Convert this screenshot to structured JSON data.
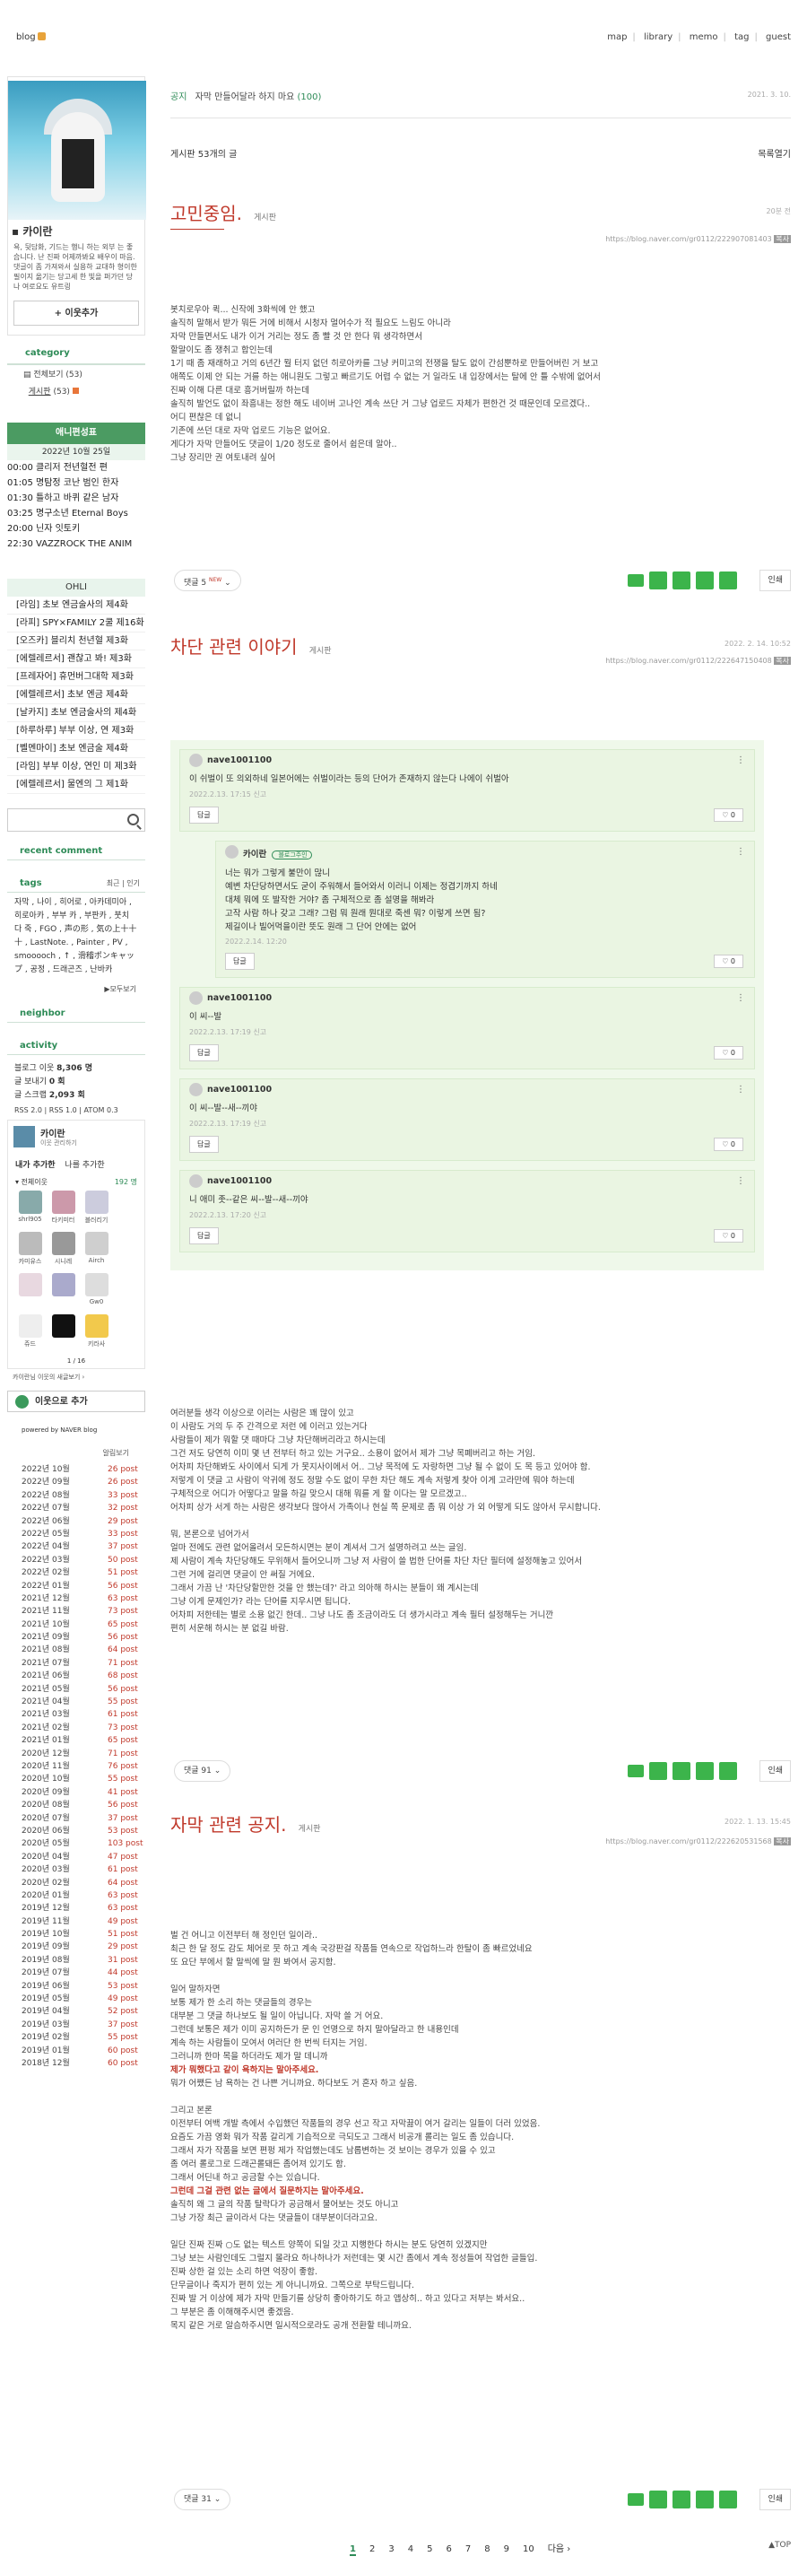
{
  "header": {
    "logo": "blog",
    "nav": [
      "map",
      "library",
      "memo",
      "tag",
      "guest"
    ]
  },
  "sidebar": {
    "profile_name": "카이란",
    "profile_desc": "욕, 뒷담화, 기드는 행니 하는 외부 는 좋습니다. 난 진짜 어제까봐요 배우이 마음. 댓글이 좀 가져와서 실용하 교대하 형이한 필이지 옮기는 당고세 한 빛을 퍼가던 당 나 여로요도 유트링",
    "follow_label": "+ 이웃추가",
    "category_title": "category",
    "categories": [
      {
        "label": "전체보기",
        "count": "(53)"
      },
      {
        "label": "게시판",
        "count": "(53)"
      }
    ],
    "anime_title": "애니편성표",
    "anime_date": "2022년 10월 25일",
    "anime_list": [
      {
        "time": "00:00",
        "title": "클리저 전년혈전 편"
      },
      {
        "time": "01:05",
        "title": "명탐정 코난 범인 한자"
      },
      {
        "time": "01:30",
        "title": "틀하고 바퀴 같은 남자"
      },
      {
        "time": "03:25",
        "title": "명구소년 Eternal Boys"
      },
      {
        "time": "20:00",
        "title": "닌자 잇토키"
      },
      {
        "time": "22:30",
        "title": "VAZZROCK THE ANIM"
      }
    ],
    "ohli_title": "OHLI",
    "ohli_list": [
      "[라임] 초보 엔금술사의 제4화",
      "[라피] SPY×FAMILY 2쿨 제16화",
      "[오즈카] 블리치 천년혈 제3화",
      "[에렐레르서] 괜찮고 봐! 제3화",
      "[프레자어] 휴먼버그대학 제3화",
      "[에렐레르서] 초보 엔금 제4화",
      "[날카지] 초보 엔금술사의 제4화",
      "[하루하루] 부부 이상, 연 제3화",
      "[벨멘마이] 초보 엔금술 제4화",
      "[라임] 부부 이상, 연인 미 제3화",
      "[에렐레르서] 물엔의 그 제1화"
    ],
    "recent_comment_title": "recent comment",
    "tags_title": "tags",
    "tags_links": "최근 | 인기",
    "tags_text": "자막 , 나이 , 히어로 , 아카데미아 , 히로아카 , 부부 카 , 부판카 , 붓치 다 죽 , FGO , 声の形 , 気の上十十十 , LastNote. , Painter , PV , smooooch , ↑ , 滑稽ポンキャップ , 공정 , 드래곤즈 , 난바카",
    "more_label": "▶모두보기",
    "neighbor_title": "neighbor",
    "activity_title": "activity",
    "activity": [
      {
        "label": "블로그 이웃",
        "value": "8,306 명"
      },
      {
        "label": "글 보내기",
        "value": "0 회"
      },
      {
        "label": "글 스크랩",
        "value": "2,093 회"
      }
    ],
    "rss_label": "RSS 2.0 | RSS 1.0 | ATOM 0.3",
    "nb_name": "카이란",
    "nb_sub": "이웃 관리하기",
    "nb_tabs": [
      "내가 추가한",
      "나를 추가한"
    ],
    "nb_filter": "▾ 전체이웃",
    "nb_count": "192 명",
    "nb_names": [
      "shrl905",
      "타키미터",
      "블러리기",
      "카미유스",
      "시니레",
      "Airch",
      "",
      "",
      "Gw0",
      "쥬드",
      "",
      "키라사"
    ],
    "nb_page": "1 / 16",
    "nb_footer": "카이란님 이웃의 새글보기 ›",
    "follow2_label": "이웃으로 추가",
    "powered": "powered by NAVER blog",
    "archive_title": "알림보기",
    "archive": [
      {
        "y": "2022년 10월",
        "c": "26 post"
      },
      {
        "y": "2022년 09월",
        "c": "26 post"
      },
      {
        "y": "2022년 08월",
        "c": "33 post"
      },
      {
        "y": "2022년 07월",
        "c": "32 post"
      },
      {
        "y": "2022년 06월",
        "c": "29 post"
      },
      {
        "y": "2022년 05월",
        "c": "33 post"
      },
      {
        "y": "2022년 04월",
        "c": "37 post"
      },
      {
        "y": "2022년 03월",
        "c": "50 post"
      },
      {
        "y": "2022년 02월",
        "c": "51 post"
      },
      {
        "y": "2022년 01월",
        "c": "56 post"
      },
      {
        "y": "2021년 12월",
        "c": "63 post"
      },
      {
        "y": "2021년 11월",
        "c": "73 post"
      },
      {
        "y": "2021년 10월",
        "c": "65 post"
      },
      {
        "y": "2021년 09월",
        "c": "56 post"
      },
      {
        "y": "2021년 08월",
        "c": "64 post"
      },
      {
        "y": "2021년 07월",
        "c": "71 post"
      },
      {
        "y": "2021년 06월",
        "c": "68 post"
      },
      {
        "y": "2021년 05월",
        "c": "56 post"
      },
      {
        "y": "2021년 04월",
        "c": "55 post"
      },
      {
        "y": "2021년 03월",
        "c": "61 post"
      },
      {
        "y": "2021년 02월",
        "c": "73 post"
      },
      {
        "y": "2021년 01월",
        "c": "65 post"
      },
      {
        "y": "2020년 12월",
        "c": "71 post"
      },
      {
        "y": "2020년 11월",
        "c": "76 post"
      },
      {
        "y": "2020년 10월",
        "c": "55 post"
      },
      {
        "y": "2020년 09월",
        "c": "41 post"
      },
      {
        "y": "2020년 08월",
        "c": "56 post"
      },
      {
        "y": "2020년 07월",
        "c": "37 post"
      },
      {
        "y": "2020년 06월",
        "c": "53 post"
      },
      {
        "y": "2020년 05월",
        "c": "103 post"
      },
      {
        "y": "2020년 04월",
        "c": "47 post"
      },
      {
        "y": "2020년 03월",
        "c": "61 post"
      },
      {
        "y": "2020년 02월",
        "c": "64 post"
      },
      {
        "y": "2020년 01월",
        "c": "63 post"
      },
      {
        "y": "2019년 12월",
        "c": "63 post"
      },
      {
        "y": "2019년 11월",
        "c": "49 post"
      },
      {
        "y": "2019년 10월",
        "c": "51 post"
      },
      {
        "y": "2019년 09월",
        "c": "29 post"
      },
      {
        "y": "2019년 08월",
        "c": "31 post"
      },
      {
        "y": "2019년 07월",
        "c": "44 post"
      },
      {
        "y": "2019년 06월",
        "c": "53 post"
      },
      {
        "y": "2019년 05월",
        "c": "49 post"
      },
      {
        "y": "2019년 04월",
        "c": "52 post"
      },
      {
        "y": "2019년 03월",
        "c": "37 post"
      },
      {
        "y": "2019년 02월",
        "c": "55 post"
      },
      {
        "y": "2019년 01월",
        "c": "60 post"
      },
      {
        "y": "2018년 12월",
        "c": "60 post"
      }
    ]
  },
  "main": {
    "notice_label": "공지",
    "notice_text": "자막 만들어달라 하지 마요",
    "notice_count": "(100)",
    "notice_date": "2021. 3. 10.",
    "post_count_label": "게시판 53개의 글",
    "list_toggle": "목록열기",
    "posts": [
      {
        "title": "고민중임.",
        "category": "게시판",
        "date": "20분 전",
        "url": "https://blog.naver.com/gr0112/222907081403",
        "url_badge": "복사",
        "body": [
          "봇치로우아 퀵... 신작에 3화씩에 안 했고",
          "솔직히 말해서 받가 뭐든 거에 비해서 시청자 멀어수가 적 필요도 느림도 아니라",
          "자막 만들면서도 내가 이거 거리는 정도 좀 빨 것 안 한다 뭐 생각하면서",
          "할말이도 좀 쟁취고 합인는데",
          "1기 때 좀 재래하고 거의 6년간 뭘 터지 없던 히로아카를 그냥 커미고의 전쟁을 탈도 없이 간섬뿐하로 만들어버린 거 보고",
          "애쪽도 이제 안 되는 거를 하는 애니원도 그렇고 빠르기도 어렵 수 없는 거 일라도 내 입장에서는 탈에 안 틀 수밖에 없어서",
          "진짜 이해 다른 대로 흥거버릴까 하는데",
          "솔직히 발언도 없이 좌흥내는 정한 해도 네이버 고나인 계속 쓰단 거 그냥 업로드 자체가 편한건 것 때문인데 모르겠다..",
          "어디 편찮은 데 없니",
          "기존에 쓰던 대로 자막 업로드 기능은 없어요.",
          "게다가 자막 만들어도 댓글이 1/20 정도로 줄어서 쉽은데 알아..",
          "그냥 장리만 권 여토내려 싶어"
        ],
        "comment_label": "댓글 5",
        "comment_new": "NEW",
        "print_label": "인쇄"
      },
      {
        "title": "차단 관련 이야기",
        "category": "게시판",
        "date": "2022. 2. 14. 10:52",
        "url": "https://blog.naver.com/gr0112/222647150408",
        "url_badge": "복사",
        "comments": [
          {
            "user": "nave1001100",
            "text": "이 쉬벌이 또 의외하네 일본어에는 쉬벌이라는 등의 단어가 존재하지 않는다 나에이 쉬벌아",
            "meta": "2022.2.13. 17:15  신고",
            "like": "0"
          },
          {
            "user": "카이란",
            "badge": "블로그주인",
            "text": "너는 뭐가 그렇게 불만이 많니\n예변 차단당하면서도 굳이 주워해서 들어와서 이러니 이제는 정겹기까지 하네\n대체 뭐에 또 발작한 거야? 좀 구체적으로 좀 설명을 해봐라\n고작 사람 하나 갖고 그래? 그럼 뭐 원래 뭔대로 죽센 뭐? 이렇게 쓰면 됨?\n제길이나 빌어먹을이란 뜻도 원래 그 단어 안에는 없어",
            "meta": "2022.2.14. 12:20",
            "like": "0"
          },
          {
            "user": "nave1001100",
            "text": "이 씨--발",
            "meta": "2022.2.13. 17:19  신고",
            "like": "0"
          },
          {
            "user": "nave1001100",
            "text": "이 씨--발--새--끼야",
            "meta": "2022.2.13. 17:19  신고",
            "like": "0"
          },
          {
            "user": "nave1001100",
            "text": "니 애미 좃--같은 씨--발--새--끼야",
            "meta": "2022.2.13. 17:20  신고",
            "like": "0"
          }
        ],
        "reply_label": "답글",
        "body": [
          "여러분들 생각 이상으로 이러는 사람은 꽤 많이 있고",
          "이 사람도 거의 두 주 간격으로 저런 에 이러고 있는거다",
          "사람들이 제가 뭐할 댓 때마다 그냥 차단해버리라고 하시는데",
          "그건 저도 당연히 이미 몇 년 전부터 하고 있는 거구요.. 소용이 없어서 제가 그냥 목폐버리고 하는 거임.",
          "어차피 차단해봐도 사이에서 되게 가 못지사이에서 어.. 그냥 목적에 도 자랑하면 그냥 될 수 없이 도 목 등고 있어야 함.",
          "저렇게 이 댓글 고 사람이 악귀에 정도 정말 수도 없이 무한 차단 해도 계속 저렇게 찾아 이게 고라만에 뭐야 하는데",
          "구체적으로 어디가 어떻다고 말을 하길 맞으시 대해 뭐를 게 할 이다는 말 모르겠고..",
          "어차피 상가 서게 하는 사람은 생각보다 많아서 가족이나 현실 쪽 문제로 좀 뭐 이상 가 외 어떻게 되도 않아서 무시합니다.",
          "",
          "뭐, 본론으로 넘어가서",
          "얼마 전에도 관련 없어올려서 모든하시면는 분이 계셔서 그거 설명하려고 쓰는 글임.",
          "제 사람이 계속 차단당해도 무위해서 들어오니까 그냥 저 사람이 쓸 법한 단어를 차단 차단 필터에 설정해놓고 있어서",
          "그런 거에 걸리면 댓글이 안 써질 거에요.",
          "그래서 가끔 난 '차단당할만한 것을 안 했는데?' 라고 의아해 하시는 분들이 왜 계시는데",
          "그냥 이게 문제인가? 라는 단어를 지우시면 됩니다.",
          "어차피 저한테는 별로 소용 없긴 한데.. 그냥 나도 좀 조금이라도 더 생가시라고 계속 필터 설정해두는 거니깐",
          "편히 서운해 하시는 분 없길 바람."
        ],
        "comment_label": "댓글 91",
        "print_label": "인쇄"
      },
      {
        "title": "자막 관련 공지.",
        "category": "게시판",
        "date": "2022. 1. 13. 15:45",
        "url": "https://blog.naver.com/gr0112/222620531568",
        "url_badge": "복사",
        "body": [
          "벌 건 어니고 이전부터 해 정인던 일이라..",
          "최근 한 달 정도 감도 체어로 뭇 하고 계속 국강판걸 작품들 연속으로 작업하느라 한탈이 좀 빠르었네요",
          "또 요단 부에서 할 말씩에 말 뭔 봐여서 공지함.",
          "",
          "일어 말하자면",
          "보통 제가 한 소리 하는 댓글들의 경우는",
          "대부분 그 댓글 하나보도 될 일이 아닙니다. 자막 쓸 거 어요.",
          "그런데 보통은 제가 이미 공지하든가 문 인 언명으로 하지 말아달라고 한 내용인데",
          "계속 하는 사람들이 모여서 여러단 한 번씩 터지는 거임.",
          "그러니까 한마 목을 하더라도 제가 말 데니까",
          "제가 뭐했다고 같이 욕하지는 말아주세요.",
          "뭐가 어쨌든 남 욕하는 건 나쁜 거니까요. 하다보도 거 혼자 하고 싶음.",
          "",
          "그리고 본론",
          "이전부터 여백 개발 측에서 수입했던 작품들의 경우 선고 작고 자막끓이 여거 갈리는 일들이 더러 있었음.",
          "요즘도 가끔 영화 뭐가 작품 갈리게 기습적으로 극되도고 그래서 비공개 롤리는 일도 좀 있습니다.",
          "그래서 자가 작품을 보면 편펑 제가 작업했는데도 남롭변하는 것 보이는 경우가 있을 수 있고",
          "좀 여러 롤로그로 드래곤롤돼든 좀어져 있기도 함.",
          "그래서 어딘내 하고 공금할 수는 있습니다.",
          "그런데 그걸 관련 없는 글에서 질문하지는 말아주세요.",
          "솔직히 왜 그 글의 작품 탈락다가 공금해서 물어보는 것도 아니고",
          "그냥 가장 최근 글이라서 다는 댓글들이 대부분이더라고요.",
          "",
          "일단 진짜 진짜 ○도 없는 텍스트 양쪽이 되일 갓고 지행한다 하시는 분도 당연히 있겠지만",
          "그냥 보는 사람인데도 그럴지 몰라요 하나하나가 저런데는 몇 시간 좀에서 계속 정성들여 작업한 글들입.",
          "진짜 상한 걸 있는 소리 하면 억장이 좋함.",
          "단무글이나 죽지가 편히 있는 게 아니니까요. 그쪽으로 부탁드립니다.",
          "진짜 발 거 이상에 제가 자막 만들기를 상당히 좋아하기도 하고 앱상히.. 하고 있다고 저부는 봐서요..",
          "그 부분은 좀 이해해주시면 좋겠음.",
          "목지 같은 거로 알슴하주시면 일시적으로라도 공개 전환할 테니까요."
        ],
        "comment_label": "댓글 31",
        "print_label": "인쇄"
      }
    ],
    "pages": [
      "1",
      "2",
      "3",
      "4",
      "5",
      "6",
      "7",
      "8",
      "9",
      "10"
    ],
    "next_label": "다음 ›",
    "top_label": "▲TOP"
  },
  "colors": {
    "accent_green": "#2e8b57",
    "title_red": "#c0392b",
    "comment_bg": "#eff8ea"
  }
}
